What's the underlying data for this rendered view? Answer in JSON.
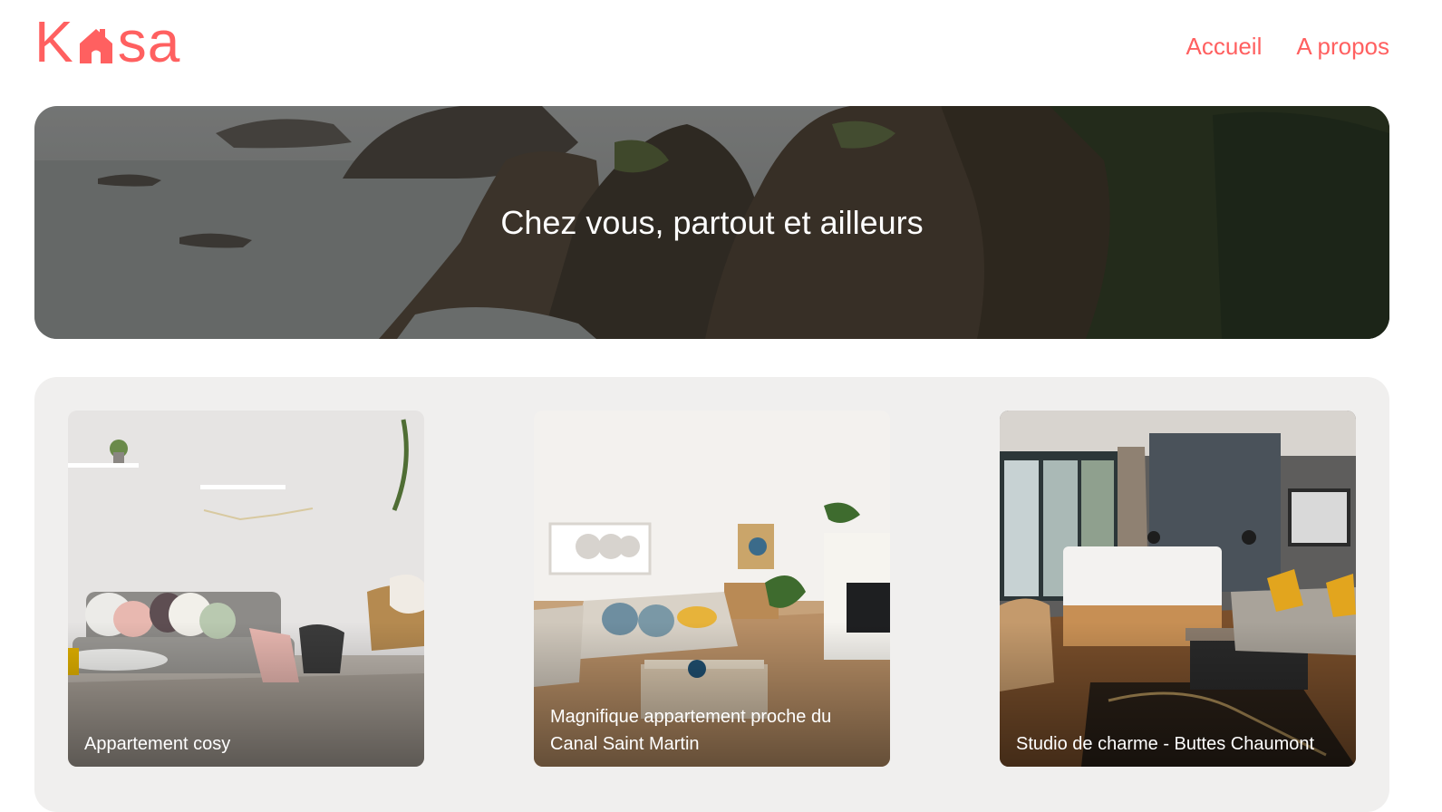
{
  "header": {
    "logo_text_left": "K",
    "logo_text_right": "sa",
    "nav": [
      {
        "label": "Accueil"
      },
      {
        "label": "A propos"
      }
    ]
  },
  "banner": {
    "title": "Chez vous, partout et ailleurs"
  },
  "listings": [
    {
      "title": "Appartement cosy"
    },
    {
      "title": "Magnifique appartement proche du Canal Saint Martin"
    },
    {
      "title": "Studio de charme - Buttes Chaumont"
    }
  ],
  "colors": {
    "brand": "#FF6060",
    "gallery_bg": "#F0EFEE"
  }
}
